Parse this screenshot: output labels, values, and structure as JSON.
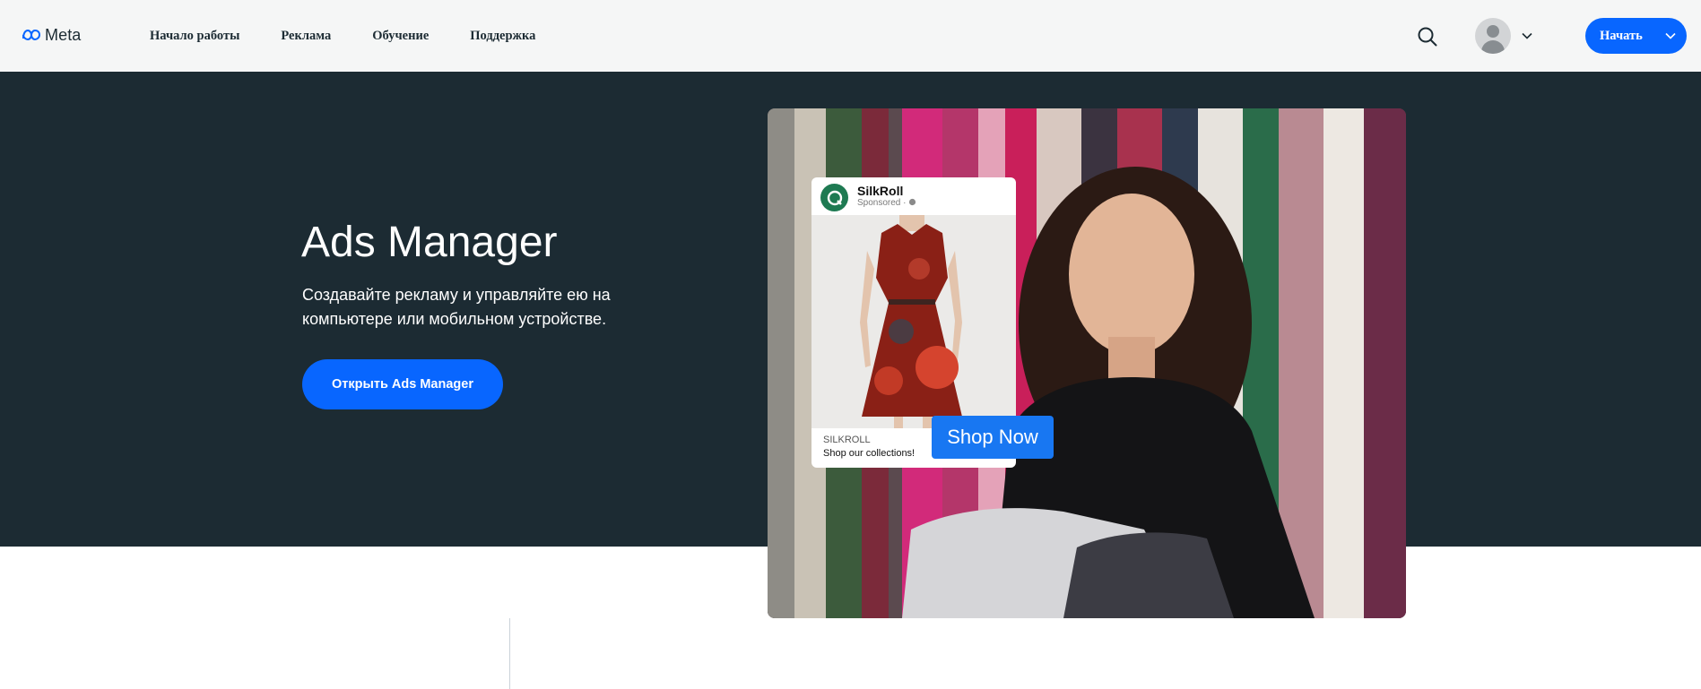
{
  "nav": {
    "logo_text": "Meta",
    "links": [
      "Начало работы",
      "Реклама",
      "Обучение",
      "Поддержка"
    ],
    "start_label": "Начать"
  },
  "hero": {
    "title": "Ads Manager",
    "description": "Создавайте рекламу и управляйте ею на компьютере или мобильном устройстве.",
    "cta_label": "Открыть Ads Manager"
  },
  "ad": {
    "brand": "SilkRoll",
    "sponsored": "Sponsored ·",
    "footer_brand": "SILKROLL",
    "footer_text": "Shop our collections!",
    "button_label": "Shop Now"
  },
  "colors": {
    "primary_blue": "#0866ff",
    "hero_bg": "#1c2b33",
    "nav_bg": "#f5f6f6",
    "ad_button": "#1877f2"
  },
  "icons": [
    "meta-logo-icon",
    "search-icon",
    "avatar-icon",
    "chevron-down-icon",
    "globe-icon"
  ]
}
